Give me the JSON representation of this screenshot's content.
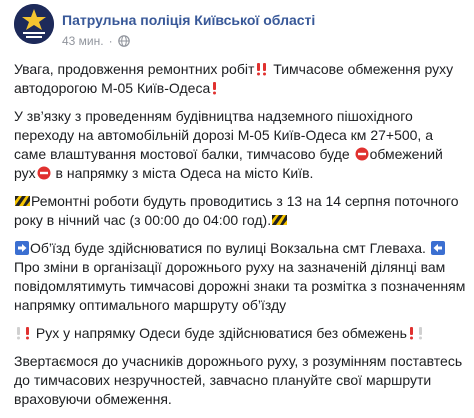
{
  "post": {
    "page_name": "Патрульна поліція Київської області",
    "time": "43 мин.",
    "separator": "·",
    "audience_icon": "globe-icon",
    "line1_a": "Увага, продовження ремонтних робіт",
    "line1_b": " Тимчасове обмеження руху автодорогою М-05 Київ-Одеса",
    "para2_a": "У зв’язку з проведенням будівництва надземного пішохідного переходу на автомобільній дорозі М-05 Київ-Одеса км 27+500, а саме влаштування мостової балки, тимчасово буде ",
    "para2_b": "обмежений рух",
    "para2_c": " в напрямку з міста Одеса на місто Київ.",
    "para3": "Ремонтні роботи будуть проводитись з 13 на 14 серпня поточного року в нічний час (з 00:00 до 04:00 год).",
    "para4_a": "Об’їзд буде здійснюватися по вулиці Вокзальна смт Глеваха.",
    "para4_b": " Про зміни в організації дорожнього руху на зазначеній ділянці вам повідомлятимуть тимчасові дорожні знаки та розмітка з позначенням напрямку оптимального маршруту об’їзду",
    "para5": " Рух у напрямку Одеси буде здійснюватися без обмежень",
    "para6": "Звертаємося до учасників дорожнього руху, з розумінням поставтесь до тимчасових незручностей, завчасно плануйте свої маршрути враховуючи обмеження.",
    "colors": {
      "link": "#385898",
      "meta": "#90949c",
      "text": "#1c1e21",
      "emoji_red": "#e0312f",
      "emoji_blue": "#3b6fd1"
    },
    "icons": [
      "double-exclamation-icon",
      "red-exclamation-icon",
      "no-entry-icon",
      "construction-icon",
      "right-arrow-icon",
      "left-arrow-icon",
      "white-exclamation-icon"
    ]
  }
}
